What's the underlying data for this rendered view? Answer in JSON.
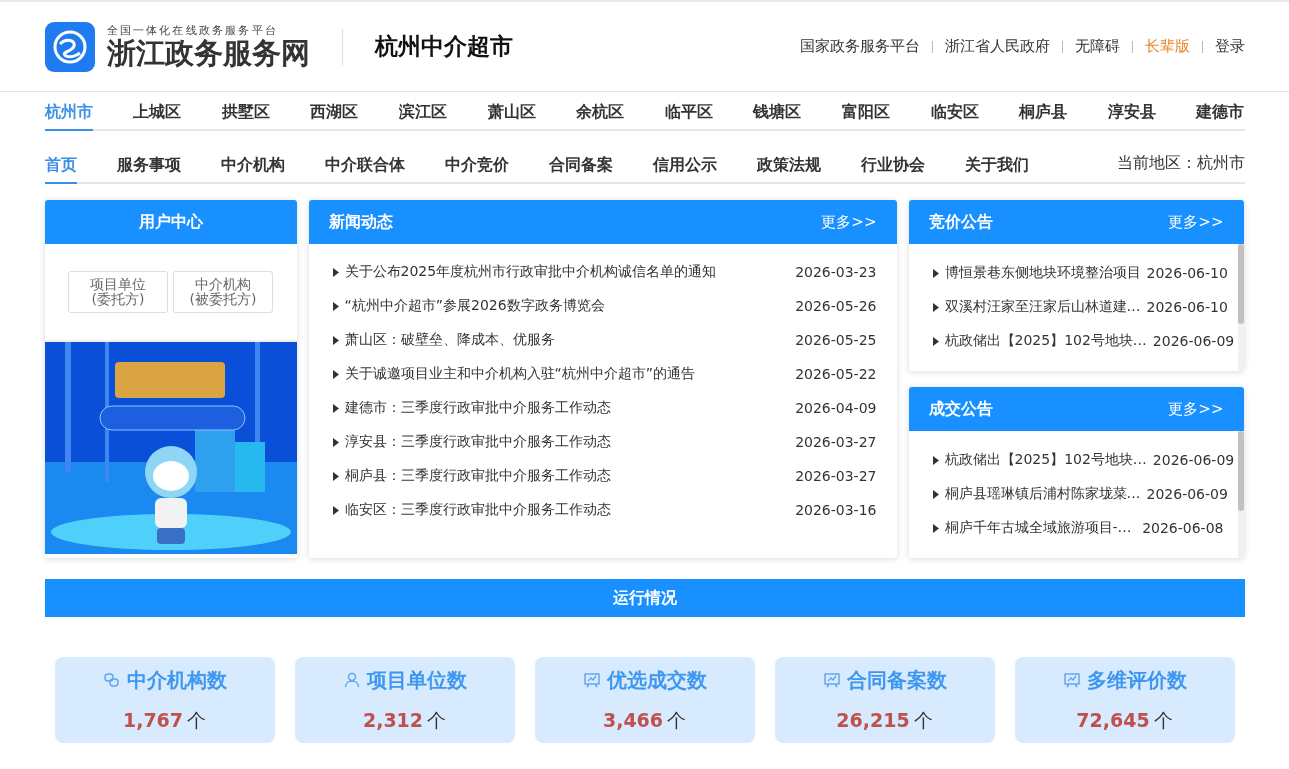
{
  "header": {
    "logo_subtitle": "全国一体化在线政务服务平台",
    "logo_title": "浙江政务服务网",
    "site_title": "杭州中介超市",
    "links": [
      {
        "label": "国家政务服务平台",
        "kind": "normal"
      },
      {
        "label": "浙江省人民政府",
        "kind": "normal"
      },
      {
        "label": "无障碍",
        "kind": "normal"
      },
      {
        "label": "长辈版",
        "kind": "highlight"
      },
      {
        "label": "登录",
        "kind": "normal"
      }
    ]
  },
  "districts": [
    {
      "label": "杭州市",
      "selected": true
    },
    {
      "label": "上城区",
      "selected": false
    },
    {
      "label": "拱墅区",
      "selected": false
    },
    {
      "label": "西湖区",
      "selected": false
    },
    {
      "label": "滨江区",
      "selected": false
    },
    {
      "label": "萧山区",
      "selected": false
    },
    {
      "label": "余杭区",
      "selected": false
    },
    {
      "label": "临平区",
      "selected": false
    },
    {
      "label": "钱塘区",
      "selected": false
    },
    {
      "label": "富阳区",
      "selected": false
    },
    {
      "label": "临安区",
      "selected": false
    },
    {
      "label": "桐庐县",
      "selected": false
    },
    {
      "label": "淳安县",
      "selected": false
    },
    {
      "label": "建德市",
      "selected": false
    }
  ],
  "nav": [
    {
      "label": "首页",
      "selected": true
    },
    {
      "label": "服务事项",
      "selected": false
    },
    {
      "label": "中介机构",
      "selected": false
    },
    {
      "label": "中介联合体",
      "selected": false
    },
    {
      "label": "中介竞价",
      "selected": false
    },
    {
      "label": "合同备案",
      "selected": false
    },
    {
      "label": "信用公示",
      "selected": false
    },
    {
      "label": "政策法规",
      "selected": false
    },
    {
      "label": "行业协会",
      "selected": false
    },
    {
      "label": "关于我们",
      "selected": false
    }
  ],
  "current_region": "当前地区：杭州市",
  "user_center": {
    "title": "用户中心",
    "buttons": [
      {
        "line1": "项目单位",
        "line2": "(委托方)"
      },
      {
        "line1": "中介机构",
        "line2": "(被委托方)"
      }
    ]
  },
  "news": {
    "title": "新闻动态",
    "more": "更多>>",
    "items": [
      {
        "title": "关于公布2025年度杭州市行政审批中介机构诚信名单的通知",
        "date": "2026-03-23"
      },
      {
        "title": "“杭州中介超市”参展2026数字政务博览会",
        "date": "2026-05-26"
      },
      {
        "title": "萧山区：破壁垒、降成本、优服务",
        "date": "2026-05-25"
      },
      {
        "title": "关于诚邀项目业主和中介机构入驻“杭州中介超市”的通告",
        "date": "2026-05-22"
      },
      {
        "title": "建德市：三季度行政审批中介服务工作动态",
        "date": "2026-04-09"
      },
      {
        "title": "淳安县：三季度行政审批中介服务工作动态",
        "date": "2026-03-27"
      },
      {
        "title": "桐庐县：三季度行政审批中介服务工作动态",
        "date": "2026-03-27"
      },
      {
        "title": "临安区：三季度行政审批中介服务工作动态",
        "date": "2026-03-16"
      }
    ]
  },
  "bidding": {
    "title": "竞价公告",
    "more": "更多>>",
    "items": [
      {
        "title": "博恒景巷东侧地块环境整治项目",
        "date": "2026-06-10"
      },
      {
        "title": "双溪村汪家至汪家后山林道建…",
        "date": "2026-06-10"
      },
      {
        "title": "杭政储出【2025】102号地块…",
        "date": "2026-06-09"
      }
    ]
  },
  "deals": {
    "title": "成交公告",
    "more": "更多>>",
    "items": [
      {
        "title": "杭政储出【2025】102号地块…",
        "date": "2026-06-09"
      },
      {
        "title": "桐庐县瑶琳镇后浦村陈家垅菜…",
        "date": "2026-06-09"
      },
      {
        "title": "桐庐千年古城全域旅游项目-…",
        "date": "2026-06-08"
      }
    ]
  },
  "operations": {
    "title": "运行情况",
    "stats": [
      {
        "kind": "org",
        "label": "中介机构数",
        "value": "1,767",
        "unit": "个"
      },
      {
        "kind": "person",
        "label": "项目单位数",
        "value": "2,312",
        "unit": "个"
      },
      {
        "kind": "chart",
        "label": "优选成交数",
        "value": "3,466",
        "unit": "个"
      },
      {
        "kind": "chart",
        "label": "合同备案数",
        "value": "26,215",
        "unit": "个"
      },
      {
        "kind": "chart",
        "label": "多维评价数",
        "value": "72,645",
        "unit": "个"
      }
    ]
  }
}
